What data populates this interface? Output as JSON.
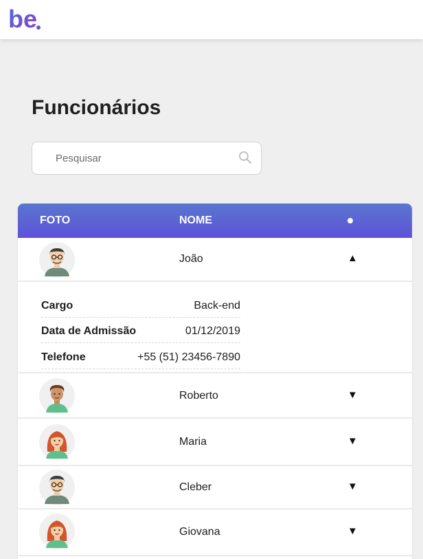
{
  "header": {
    "logo_text": "be",
    "brand_colors": [
      "#4a6fe0",
      "#8a3ec8"
    ]
  },
  "page": {
    "title": "Funcionários"
  },
  "search": {
    "placeholder": "Pesquisar"
  },
  "table": {
    "columns": {
      "foto": "FOTO",
      "nome": "NOME"
    },
    "header_gradient": [
      "#5a76cf",
      "#5d52d8"
    ],
    "detail_labels": {
      "cargo": "Cargo",
      "admissao": "Data de Admissão",
      "telefone": "Telefone"
    },
    "rows": [
      {
        "name": "João",
        "expanded": true,
        "toggle": "▲",
        "avatar": "man-glasses-avatar",
        "details": {
          "cargo": "Back-end",
          "admissao": "01/12/2019",
          "telefone": "+55 (51) 23456-7890"
        }
      },
      {
        "name": "Roberto",
        "expanded": false,
        "toggle": "▼",
        "avatar": "man-curly-avatar"
      },
      {
        "name": "Maria",
        "expanded": false,
        "toggle": "▼",
        "avatar": "woman-red-hair-avatar"
      },
      {
        "name": "Cleber",
        "expanded": false,
        "toggle": "▼",
        "avatar": "man-glasses-avatar"
      },
      {
        "name": "Giovana",
        "expanded": false,
        "toggle": "▼",
        "avatar": "woman-red-hair-avatar"
      }
    ]
  }
}
